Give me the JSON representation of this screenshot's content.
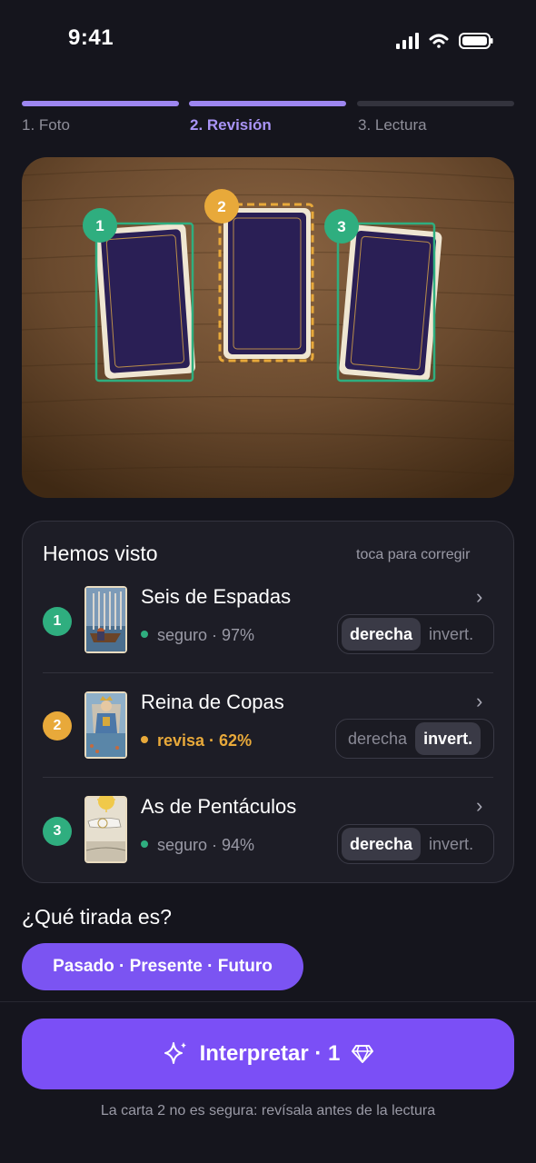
{
  "status": {
    "time": "9:41"
  },
  "steps": [
    {
      "label": "1. Foto",
      "state": "done"
    },
    {
      "label": "2. Revisión",
      "state": "active"
    },
    {
      "label": "3. Lectura",
      "state": "pending"
    }
  ],
  "photo": {
    "markers": [
      "1",
      "2",
      "3"
    ]
  },
  "panel": {
    "title": "Hemos visto",
    "hint": "toca para corregir",
    "cards": [
      {
        "number": "1",
        "name": "Seis de Espadas",
        "confidence": "seguro · 97%",
        "status": "seguro",
        "orientation": "derecha",
        "options": [
          "derecha",
          "invert."
        ],
        "color": "#2fae7f"
      },
      {
        "number": "2",
        "name": "Reina de Copas",
        "confidence": "revisa · 62%",
        "status": "revisa",
        "orientation": "invert.",
        "options": [
          "derecha",
          "invert."
        ],
        "color": "#e8a93a"
      },
      {
        "number": "3",
        "name": "As de Pentáculos",
        "confidence": "seguro · 94%",
        "status": "seguro",
        "orientation": "derecha",
        "options": [
          "derecha",
          "invert."
        ],
        "color": "#2fae7f"
      }
    ]
  },
  "spread": {
    "question": "¿Qué tirada es?",
    "selected": "Pasado · Presente · Futuro"
  },
  "cta": {
    "label": "Interpretar · 1",
    "icon": "sparkle-icon",
    "cost_icon": "gem-icon"
  },
  "warning": "La carta 2 no es segura: revísala antes de la lectura",
  "colors": {
    "accent": "#7b4ff6",
    "safe": "#2fae7f",
    "review": "#e8a93a",
    "background": "#15151d"
  }
}
